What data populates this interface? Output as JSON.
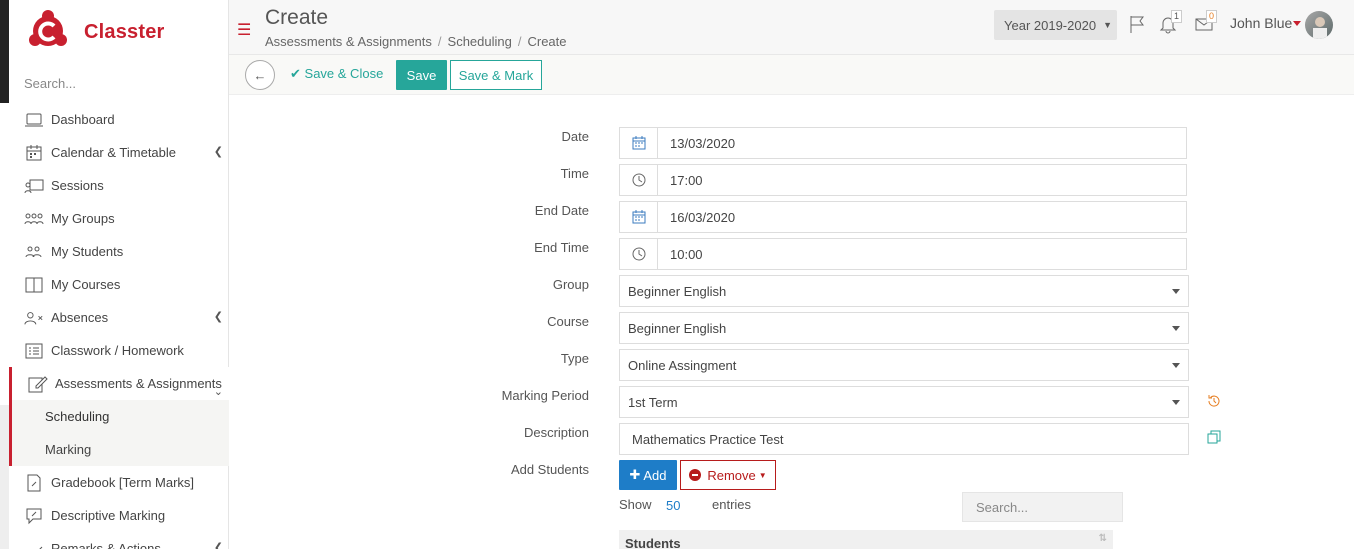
{
  "brand": {
    "name": "Classter"
  },
  "sidebar": {
    "search_placeholder": "Search...",
    "items": [
      {
        "label": "Dashboard",
        "icon": "laptop-icon"
      },
      {
        "label": "Calendar & Timetable",
        "icon": "calendar-icon"
      },
      {
        "label": "Sessions",
        "icon": "presentation-icon"
      },
      {
        "label": "My Groups",
        "icon": "group-icon"
      },
      {
        "label": "My Students",
        "icon": "students-icon"
      },
      {
        "label": "My Courses",
        "icon": "book-icon"
      },
      {
        "label": "Absences",
        "icon": "user-x-icon"
      },
      {
        "label": "Classwork / Homework",
        "icon": "list-icon"
      },
      {
        "label": "Assessments & Assignments",
        "icon": "edit-icon"
      },
      {
        "label": "Scheduling"
      },
      {
        "label": "Marking"
      },
      {
        "label": "Gradebook [Term Marks]",
        "icon": "document-icon"
      },
      {
        "label": "Descriptive Marking",
        "icon": "comment-icon"
      },
      {
        "label": "Remarks & Actions",
        "icon": "remarks-icon"
      }
    ]
  },
  "header": {
    "title": "Create",
    "breadcrumb": [
      "Assessments & Assignments",
      "Scheduling",
      "Create"
    ],
    "year": "Year 2019-2020",
    "notifications_count": "1",
    "messages_count": "0",
    "user": "John Blue"
  },
  "toolbar": {
    "save_close": "Save & Close",
    "save": "Save",
    "save_mark": "Save & Mark"
  },
  "form": {
    "date_label": "Date",
    "date": "13/03/2020",
    "time_label": "Time",
    "time": "17:00",
    "end_date_label": "End Date",
    "end_date": "16/03/2020",
    "end_time_label": "End Time",
    "end_time": "10:00",
    "group_label": "Group",
    "group": "Beginner English",
    "course_label": "Course",
    "course": "Beginner English",
    "type_label": "Type",
    "type": "Online Assingment",
    "period_label": "Marking Period",
    "period": "1st Term",
    "desc_label": "Description",
    "desc": "Mathematics Practice Test",
    "students_label": "Add Students",
    "add": "Add",
    "remove": "Remove"
  },
  "table": {
    "show": "Show",
    "page_size": "50",
    "entries": "entries",
    "search_placeholder": "Search...",
    "column": "Students"
  },
  "colors": {
    "brand": "#c8202f",
    "primary": "#26a69a",
    "blue": "#1e7dc8",
    "danger": "#b71c1c"
  }
}
